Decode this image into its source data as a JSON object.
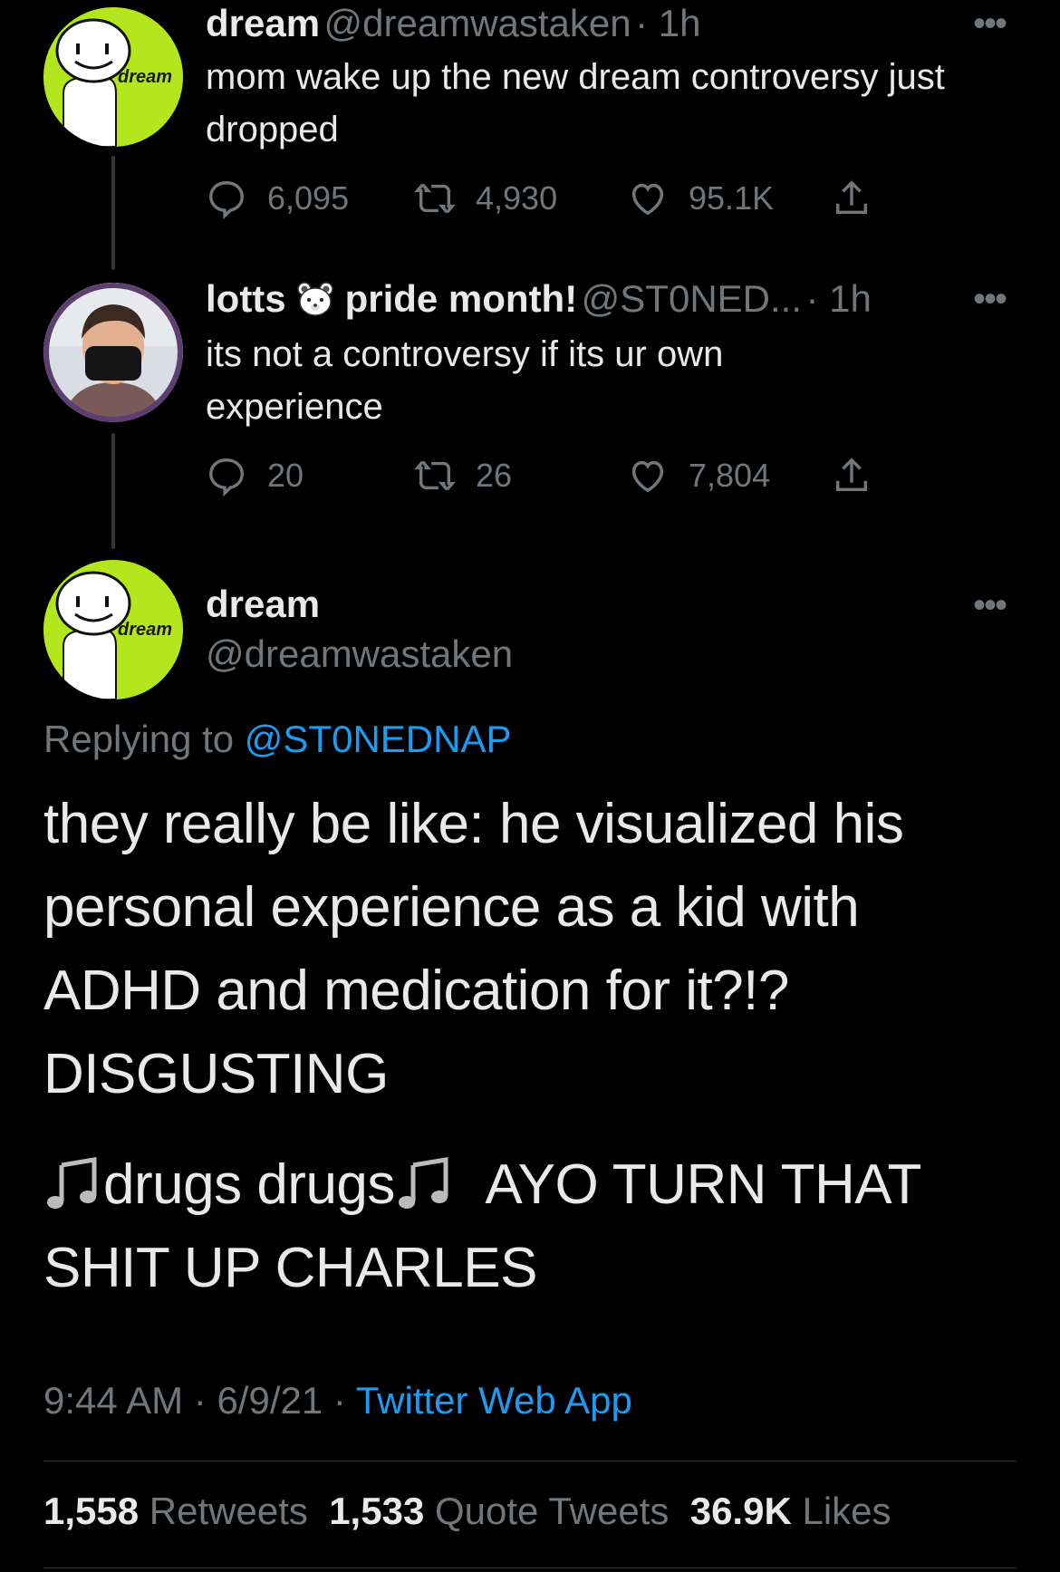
{
  "tweets": [
    {
      "name": "dream",
      "handle": "@dreamwastaken",
      "time": "· 1h",
      "text": "mom wake up the new dream controversy just dropped",
      "replies": "6,095",
      "retweets": "4,930",
      "likes": "95.1K",
      "avatar_label": "dream"
    },
    {
      "name": "lotts",
      "name_suffix": "pride month!",
      "handle": "@ST0NED...",
      "time": "· 1h",
      "text": "its not a controversy if its ur own experience",
      "replies": "20",
      "retweets": "26",
      "likes": "7,804"
    }
  ],
  "main_tweet": {
    "name": "dream",
    "handle": "@dreamwastaken",
    "avatar_label": "dream",
    "replying_prefix": "Replying to",
    "replying_to": "@ST0NEDNAP",
    "text_lines": [
      "they really be like: he visualized his",
      "personal experience as a kid with",
      "ADHD and medication for it?!?",
      "DISGUSTING"
    ],
    "text_line5_a": "drugs drugs",
    "text_line5_b": "AYO TURN THAT",
    "text_line6": "SHIT UP CHARLES",
    "time": "9:44 AM",
    "date": "6/9/21",
    "source": "Twitter Web App",
    "retweets_count": "1,558",
    "retweets_label": "Retweets",
    "quotes_count": "1,533",
    "quotes_label": "Quote Tweets",
    "likes_count": "36.9K",
    "likes_label": "Likes"
  },
  "more_label": "•••",
  "colors": {
    "background": "#000000",
    "link": "#1d9bf0",
    "muted": "#71767b",
    "text": "#e7e9ea",
    "avatar_green": "#b4e61e"
  }
}
